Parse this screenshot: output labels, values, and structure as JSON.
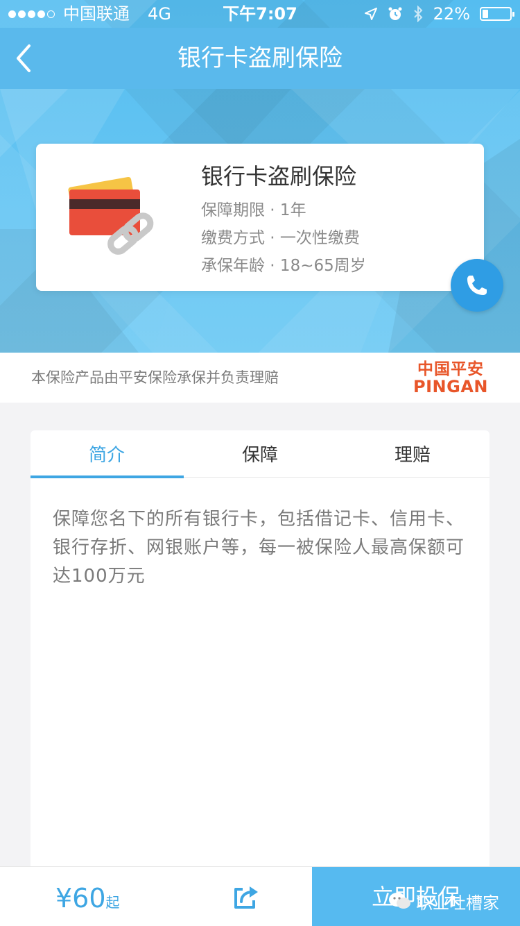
{
  "status_bar": {
    "carrier": "中国联通",
    "network": "4G",
    "time": "下午7:07",
    "battery_text": "22%",
    "battery_level": 0.22
  },
  "nav": {
    "title": "银行卡盗刷保险"
  },
  "product": {
    "title": "银行卡盗刷保险",
    "term": "保障期限 · 1年",
    "payment": "缴费方式 · 一次性缴费",
    "age": "承保年龄 · 18~65周岁"
  },
  "underwriter": {
    "text": "本保险产品由平安保险承保并负责理赔",
    "logo_cn": "中国平安",
    "logo_en": "PINGAN"
  },
  "tabs": [
    {
      "label": "简介",
      "active": true
    },
    {
      "label": "保障",
      "active": false
    },
    {
      "label": "理赔",
      "active": false
    }
  ],
  "intro": {
    "text": "保障您名下的所有银行卡，包括借记卡、信用卡、银行存折、网银账户等，每一被保险人最高保额可达100万元"
  },
  "bottom_bar": {
    "price": "¥60",
    "price_suffix": "起",
    "cta": "立即投保"
  },
  "watermark": {
    "text": "职业吐槽家"
  },
  "colors": {
    "accent": "#3ea6e3",
    "nav_bg": "#5ab9ec",
    "cta_bg": "#56baf0",
    "logo": "#e8562a"
  },
  "icons": {
    "back": "chevron-left-icon",
    "phone": "phone-icon",
    "share": "share-icon",
    "card_illustration": "bank-card-link-icon"
  }
}
